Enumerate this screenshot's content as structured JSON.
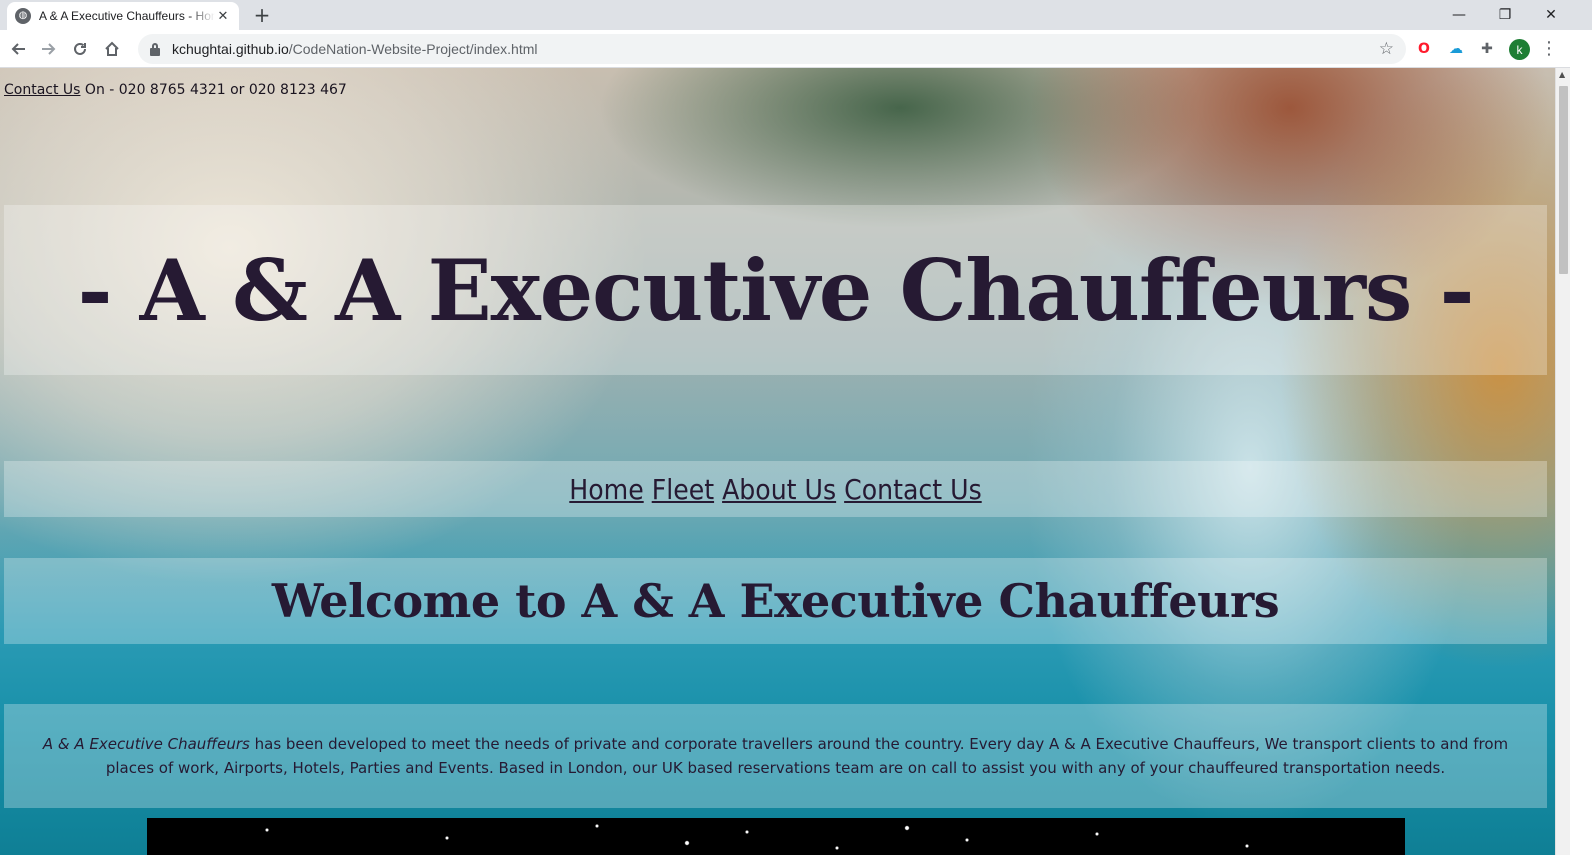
{
  "browser": {
    "tab_title": "A & A Executive Chauffeurs - Home",
    "tab_close": "✕",
    "new_tab": "+",
    "window_controls": {
      "minimize": "—",
      "restore": "❐",
      "close": "✕"
    },
    "url_host": "kchughtai.github.io",
    "url_path": "/CodeNation-Website-Project/index.html",
    "profile_initial": "k",
    "icons": {
      "back": "arrow-left-icon",
      "forward": "arrow-right-icon",
      "reload": "reload-icon",
      "home": "home-icon",
      "lock": "lock-icon",
      "bookmark": "star-icon",
      "extensions": [
        "opera-icon",
        "cloud-icon",
        "puzzle-icon"
      ],
      "menu": "kebab-menu-icon"
    }
  },
  "page": {
    "contact_link": "Contact Us",
    "contact_text": " On - 020 8765 4321 or 020 8123 467",
    "site_title": "- A & A Executive Chauffeurs -",
    "nav": [
      "Home",
      "Fleet",
      "About Us",
      "Contact Us"
    ],
    "welcome_heading": "Welcome to A & A Executive Chauffeurs",
    "intro_emphasis": "A & A Executive Chauffeurs",
    "intro_text": " has been developed to meet the needs of private and corporate travellers around the country. Every day A & A Executive Chauffeurs, We transport clients to and from places of work, Airports, Hotels, Parties and Events. Based in London, our UK based reservations team are on call to assist you with any of your chauffeured transportation needs."
  },
  "colors": {
    "heading_text": "#261a33",
    "chrome_tabstrip": "#dee1e6",
    "omnibox": "#f1f3f4",
    "avatar": "#1e7e34"
  }
}
